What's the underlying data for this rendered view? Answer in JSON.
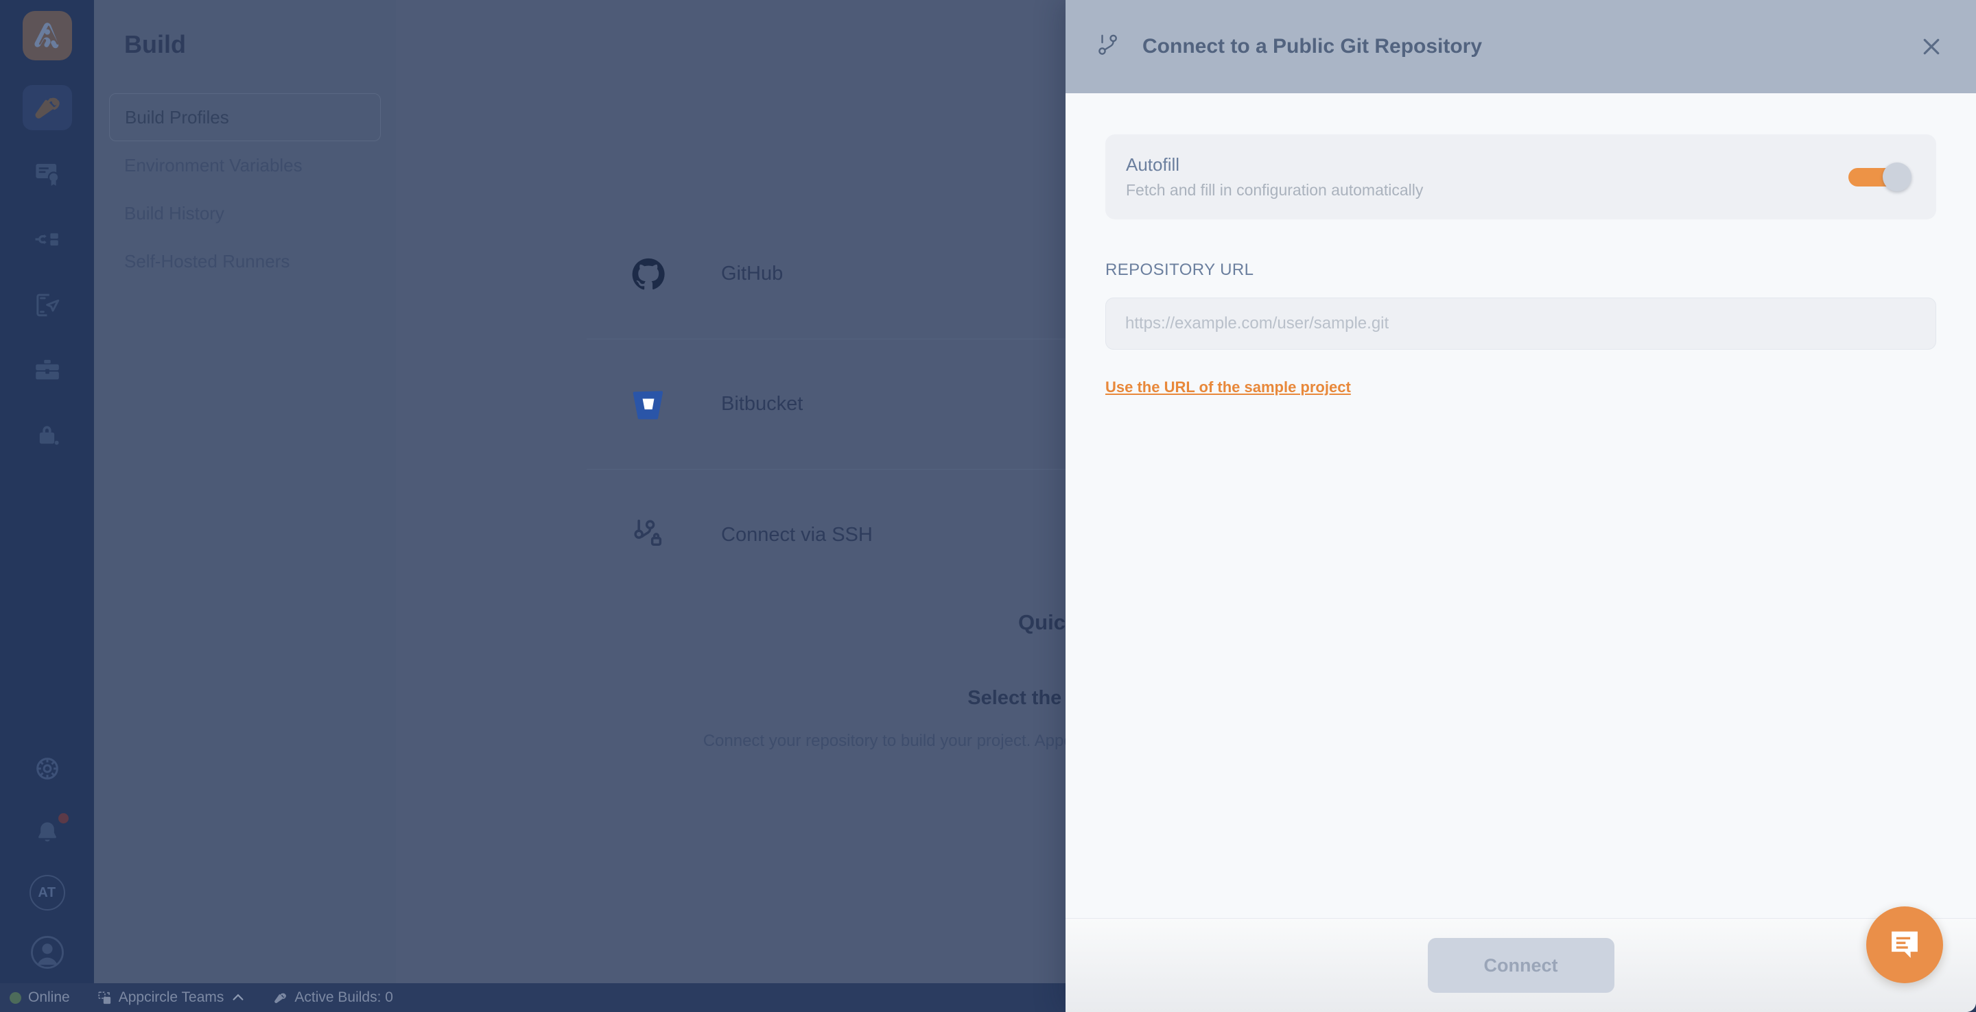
{
  "rail": {
    "logo_name": "appcircle-logo",
    "items": [
      {
        "name": "build",
        "icon": "hammer-icon",
        "active": true
      },
      {
        "name": "signing",
        "icon": "certificate-icon",
        "active": false
      },
      {
        "name": "distribute",
        "icon": "flow-icon",
        "active": false
      },
      {
        "name": "testing",
        "icon": "device-send-icon",
        "active": false
      },
      {
        "name": "store",
        "icon": "toolbox-icon",
        "active": false
      },
      {
        "name": "enterprise",
        "icon": "lock-bag-icon",
        "active": false
      }
    ],
    "bottom": [
      {
        "name": "settings",
        "icon": "gear-icon"
      },
      {
        "name": "notifications",
        "icon": "bell-icon"
      },
      {
        "name": "organization",
        "icon": "org-avatar",
        "initials": "AT"
      },
      {
        "name": "profile",
        "icon": "user-avatar"
      }
    ]
  },
  "sidebar": {
    "title": "Build",
    "items": [
      {
        "label": "Build Profiles",
        "active": true
      },
      {
        "label": "Environment Variables",
        "active": false
      },
      {
        "label": "Build History",
        "active": false
      },
      {
        "label": "Self-Hosted Runners",
        "active": false
      }
    ]
  },
  "main": {
    "git_providers": [
      {
        "label": "GitHub",
        "icon": "github-icon"
      },
      {
        "label": "Bitbucket",
        "icon": "bitbucket-icon"
      },
      {
        "label": "Connect via SSH",
        "icon": "git-ssh-icon"
      }
    ],
    "quickstart_title": "Quick start",
    "quickstart_subtitle": "Select the Git provider",
    "quickstart_body": "Connect your repository to build your project. Appcircle needs permissions to enable automatic builds."
  },
  "statusbar": {
    "online_label": "Online",
    "team_label": "Appcircle Teams",
    "team_chevron": "chevron-up-icon",
    "builds_label": "Active Builds: 0"
  },
  "modal": {
    "icon": "git-branch-icon",
    "title": "Connect to a Public Git Repository",
    "close_icon": "close-icon",
    "autofill": {
      "title": "Autofill",
      "description": "Fetch and fill in configuration automatically",
      "toggle_on": true
    },
    "repository": {
      "label": "REPOSITORY URL",
      "value": "",
      "placeholder": "https://example.com/user/sample.git"
    },
    "sample_link": "Use the URL of the sample project",
    "connect_label": "Connect",
    "connect_disabled": true
  },
  "chat": {
    "icon": "chat-message-icon"
  },
  "colors": {
    "accent_orange": "#ea8f49",
    "rail_bg": "#25375c",
    "sidebar_bg": "#4c5a76",
    "content_bg": "#4e5b77",
    "modal_header": "#aab5c6",
    "modal_body": "#f7f9fb",
    "link_orange": "#e8883a",
    "status_online": "#4d6b5a"
  }
}
